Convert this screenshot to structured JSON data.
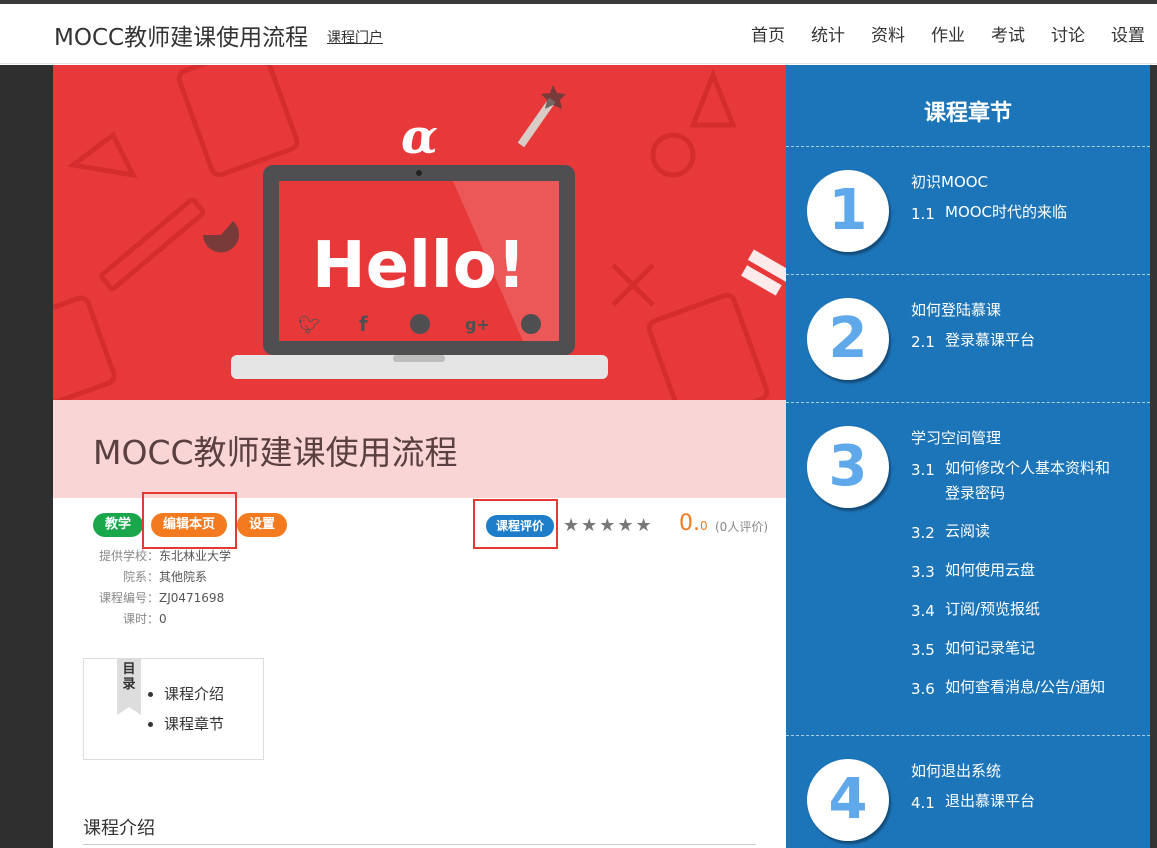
{
  "header": {
    "site_title": "MOCC教师建课使用流程",
    "portal_link": "课程门户",
    "nav": [
      "首页",
      "统计",
      "资料",
      "作业",
      "考试",
      "讨论",
      "设置"
    ]
  },
  "banner": {
    "hello_text": "Hello!",
    "alpha_glyph": "α"
  },
  "course": {
    "title": "MOCC教师建课使用流程",
    "tags": {
      "teach": "教学",
      "edit": "编辑本页",
      "settings": "设置"
    },
    "eval_label": "课程评价",
    "score_main": "0.",
    "score_decimal": "0",
    "review_count": "(0人评价)",
    "info": [
      {
        "label": "提供学校：",
        "value": "东北林业大学"
      },
      {
        "label": "院系：",
        "value": "其他院系"
      },
      {
        "label": "课程编号：",
        "value": "ZJ0471698"
      },
      {
        "label": "课时：",
        "value": "0"
      }
    ]
  },
  "toc": {
    "ribbon": "目录",
    "items": [
      "课程介绍",
      "课程章节"
    ]
  },
  "intro_heading": "课程介绍",
  "sidebar": {
    "title": "课程章节",
    "chapters": [
      {
        "num": "1",
        "title": "初识MOOC",
        "sections": [
          {
            "num": "1.1",
            "title": "MOOC时代的来临"
          }
        ]
      },
      {
        "num": "2",
        "title": "如何登陆慕课",
        "sections": [
          {
            "num": "2.1",
            "title": "登录慕课平台"
          }
        ]
      },
      {
        "num": "3",
        "title": "学习空间管理",
        "sections": [
          {
            "num": "3.1",
            "title": "如何修改个人基本资料和",
            "title2": "登录密码"
          },
          {
            "num": "3.2",
            "title": "云阅读"
          },
          {
            "num": "3.3",
            "title": "如何使用云盘"
          },
          {
            "num": "3.4",
            "title": "订阅/预览报纸"
          },
          {
            "num": "3.5",
            "title": "如何记录笔记"
          },
          {
            "num": "3.6",
            "title": "如何查看消息/公告/通知"
          }
        ]
      },
      {
        "num": "4",
        "title": "如何退出系统",
        "sections": [
          {
            "num": "4.1",
            "title": "退出慕课平台"
          }
        ]
      }
    ]
  },
  "colors": {
    "banner_red": "#e8393a",
    "sidebar_blue": "#1d75b9",
    "green_tag": "#1aa64b",
    "orange_tag": "#f47a1f",
    "blue_tag": "#1d7dc9",
    "highlight_box": "#e53935"
  }
}
